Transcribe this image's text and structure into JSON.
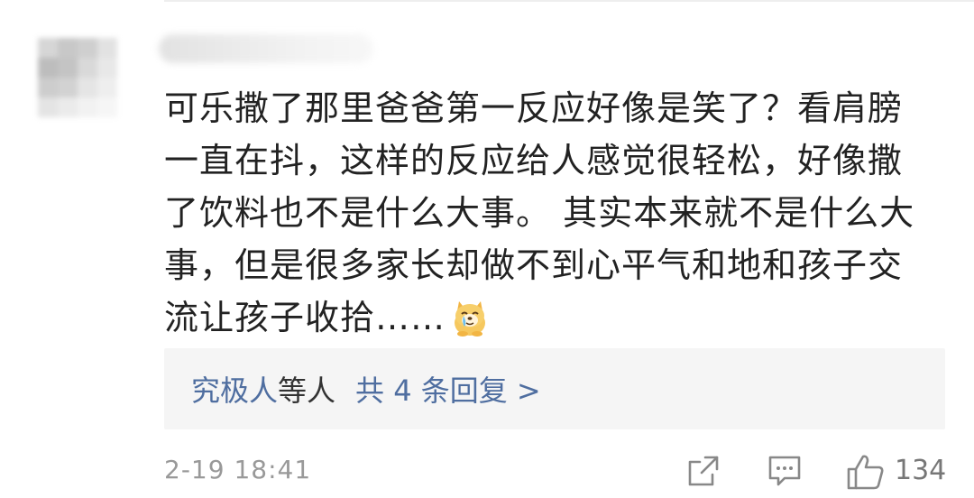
{
  "comment": {
    "text_lines": [
      "可乐撒了那里爸爸第一反应好像是笑了？看肩膀",
      "一直在抖，这样的反应给人感觉很轻松，好像撒",
      "了饮料也不是什么大事。 其实本来就不是什么大",
      "事，但是很多家长却做不到心平气和地和孩子交",
      "流让孩子收拾……"
    ],
    "emoji": "doge-tears-emoji"
  },
  "replies": {
    "user": "究极人",
    "mid": "等人",
    "count_label": "共 4 条回复 >"
  },
  "footer": {
    "timestamp": "2-19 18:41",
    "like_count": "134",
    "icons": [
      "share-icon",
      "comment-icon",
      "like-icon"
    ]
  },
  "colors": {
    "link": "#4f6ea0",
    "text": "#222222",
    "meta": "#999999",
    "reply_bg": "#f5f5f5"
  }
}
